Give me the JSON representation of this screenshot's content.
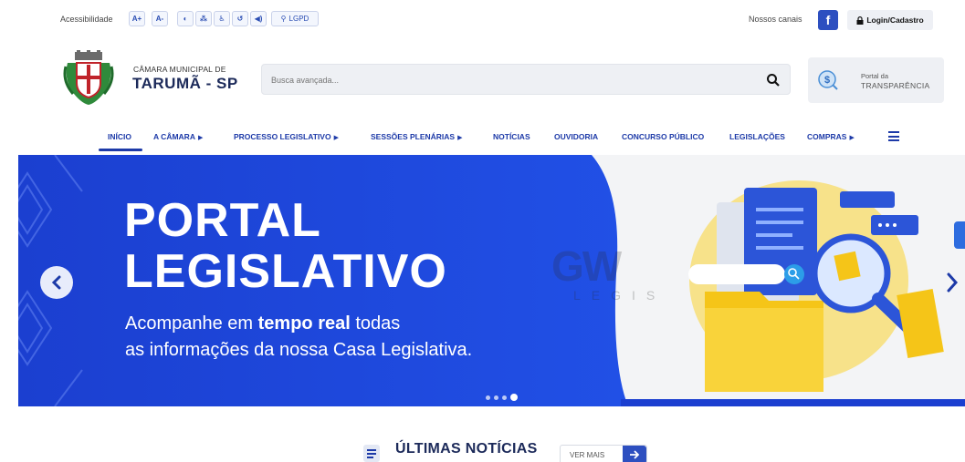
{
  "accessibility": {
    "label": "Acessibilidade",
    "buttons": [
      {
        "label": "A+",
        "icon": "font-increase-icon"
      },
      {
        "label": "A-",
        "icon": "font-decrease-icon"
      },
      {
        "label": "◐",
        "icon": "contrast-icon"
      },
      {
        "label": "⁂",
        "icon": "sitemap-icon"
      },
      {
        "label": "♿",
        "icon": "accessibility-icon"
      },
      {
        "label": "↺",
        "icon": "reset-icon"
      },
      {
        "label": "◀)",
        "icon": "audio-icon"
      }
    ],
    "lgpd_label": "LGPD"
  },
  "social": {
    "label": "Nossos canais",
    "facebook_glyph": "f"
  },
  "login_label": "Login/Cadastro",
  "header": {
    "org_line1": "CÂMARA MUNICIPAL DE",
    "org_line2": "TARUMÃ - SP",
    "search_placeholder": "Busca avançada...",
    "transparency_line1": "Portal da",
    "transparency_line2": "TRANSPARÊNCIA"
  },
  "nav": {
    "items": [
      {
        "label": "INÍCIO",
        "has_submenu": false,
        "active": true
      },
      {
        "label": "A CÂMARA",
        "has_submenu": true
      },
      {
        "label": "PROCESSO LEGISLATIVO",
        "has_submenu": true
      },
      {
        "label": "SESSÕES PLENÁRIAS",
        "has_submenu": true
      },
      {
        "label": "NOTÍCIAS",
        "has_submenu": false
      },
      {
        "label": "OUVIDORIA",
        "has_submenu": false
      },
      {
        "label": "CONCURSO PÚBLICO",
        "has_submenu": false
      },
      {
        "label": "LEGISLAÇÕES",
        "has_submenu": false
      },
      {
        "label": "COMPRAS",
        "has_submenu": true
      }
    ],
    "submenu_caret": "▶"
  },
  "banner": {
    "title_line1": "PORTAL",
    "title_line2": "LEGISLATIVO",
    "subtitle_prefix": "Acompanhe em ",
    "subtitle_bold": "tempo real",
    "subtitle_suffix": " todas",
    "subtitle_line2": "as informações da nossa Casa Legislativa.",
    "watermark_main": "GW",
    "watermark_sub": "LEGIS",
    "slides_total": 4,
    "active_slide": 4
  },
  "news": {
    "title": "ÚLTIMAS NOTÍCIAS",
    "see_more_label": "VER MAIS"
  },
  "colors": {
    "primary": "#1d3aa8",
    "banner_blue": "#1f45d6",
    "accent_yellow": "#f5c518",
    "facebook": "#2d4fc0"
  }
}
